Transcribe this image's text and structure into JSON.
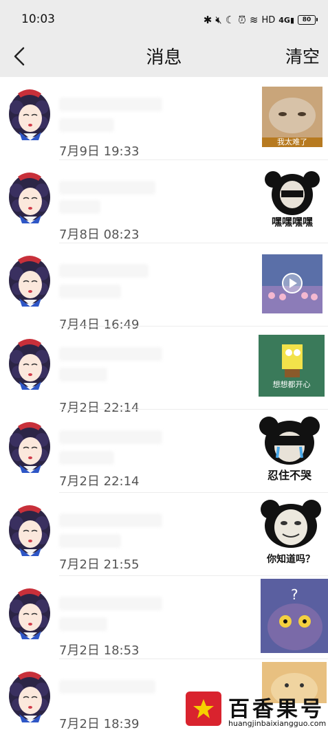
{
  "status_bar": {
    "time": "10:03",
    "hd_label": "HD",
    "network_label": "4G",
    "battery_level": "80"
  },
  "header": {
    "title": "消息",
    "clear_label": "清空"
  },
  "messages": [
    {
      "date": "7月9日 19:33",
      "thumb_caption": "我太难了",
      "thumb_icon": "cat-sticker"
    },
    {
      "date": "7月8日 08:23",
      "thumb_caption": "嘿嘿嘿嘿",
      "thumb_icon": "panda-meme"
    },
    {
      "date": "7月4日 16:49",
      "thumb_caption": "",
      "thumb_icon": "video-play-icon"
    },
    {
      "date": "7月2日 22:14",
      "thumb_caption": "想想都开心",
      "thumb_icon": "spongebob-sticker"
    },
    {
      "date": "7月2日 22:14",
      "thumb_caption": "忍住不哭",
      "thumb_icon": "panda-crying-meme"
    },
    {
      "date": "7月2日 21:55",
      "thumb_caption": "你知道吗？",
      "thumb_icon": "panda-meme"
    },
    {
      "date": "7月2日 18:53",
      "thumb_caption": "",
      "thumb_icon": "cartoon-cat-sticker"
    },
    {
      "date": "7月2日 18:39",
      "thumb_caption": "",
      "thumb_icon": "dog-sticker"
    }
  ],
  "watermark": {
    "brand": "百香果号",
    "url": "huangjinbaixiangguo.com"
  },
  "colors": {
    "header_bg": "#ececec",
    "date_text": "#555555",
    "logo_red": "#d9232e"
  }
}
